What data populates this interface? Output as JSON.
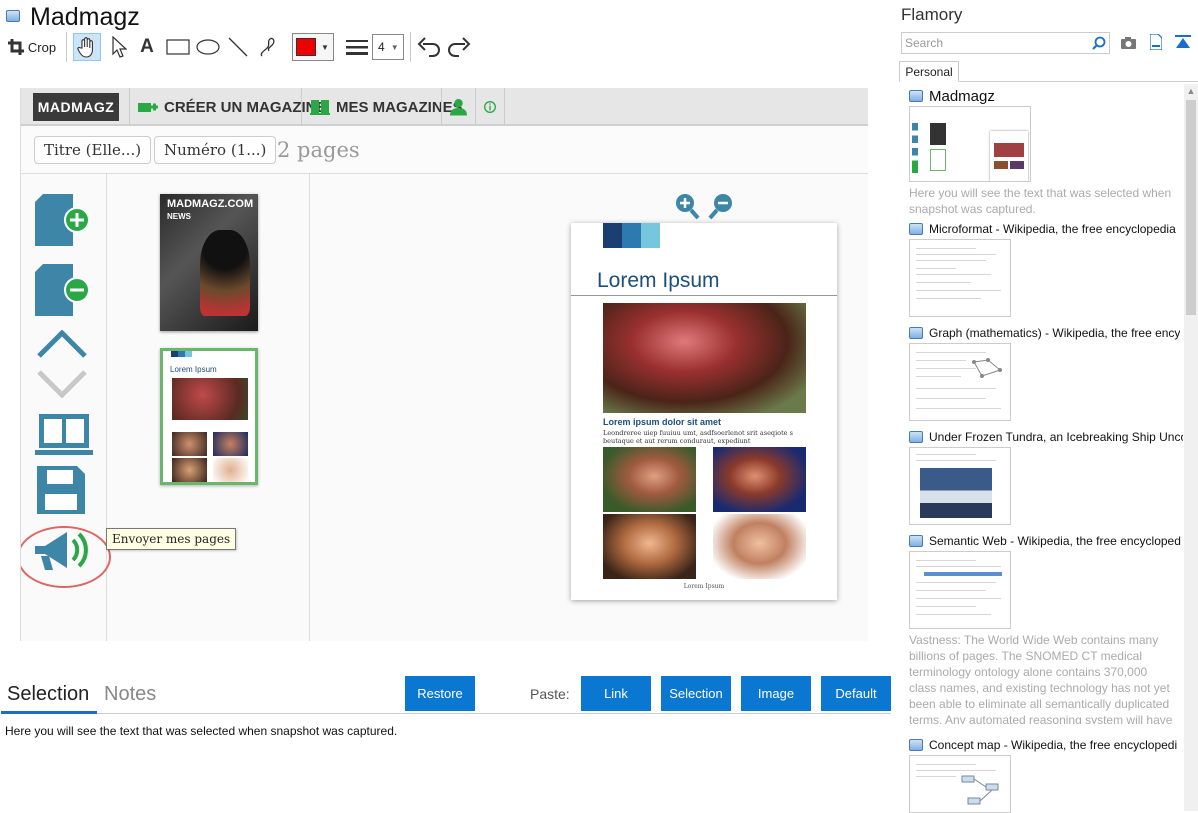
{
  "window": {
    "title": "Madmagz"
  },
  "toolbar": {
    "crop_label": "Crop",
    "pen_size": "4",
    "color": "#ee0000"
  },
  "madmagz": {
    "logo": "MADMAGZ",
    "nav": [
      "CRÉER UN MAGAZINE",
      "MES MAGAZINES"
    ],
    "filter_title": "Titre (Elle...)",
    "filter_number": "Numéro (1...)",
    "page_count": "2 pages",
    "tooltip": "Envoyer mes pages",
    "cover": {
      "brand": "MADMAGZ.COM",
      "section": "NEWS"
    },
    "thumb_title": "Lorem Ipsum",
    "preview": {
      "title": "Lorem Ipsum",
      "caption": "Lorem ipsum dolor sit amet",
      "body": "Leondreree uiep fuuiuu umt, asdfsoerlenot srit aseqiote s beutaque et aut rerum conduraut, expediunt",
      "footer": "Lorem Ipsum"
    }
  },
  "bottom_panel": {
    "tabs": [
      "Selection",
      "Notes"
    ],
    "restore_label": "Restore",
    "paste_label": "Paste:",
    "paste_buttons": [
      "Link",
      "Selection",
      "Image",
      "Default"
    ],
    "selection_text": "Here you will see the text that was selected when snapshot was captured."
  },
  "sidebar": {
    "title": "Flamory",
    "search_placeholder": "Search",
    "tab": "Personal",
    "snapshots": [
      {
        "title": "Madmagz",
        "desc": "Here you will see the text that was selected when snapshot was captured."
      },
      {
        "title": "Microformat - Wikipedia, the free encyclopedia"
      },
      {
        "title": "Graph (mathematics) - Wikipedia, the free ency"
      },
      {
        "title": "Under Frozen Tundra, an Icebreaking Ship Unco"
      },
      {
        "title": "Semantic Web - Wikipedia, the free encycloped",
        "desc": "Vastness: The World Wide Web contains many billions of pages. The SNOMED CT medical terminology ontology alone contains 370,000 class names, and existing technology has not yet been able to eliminate all semantically duplicated terms. Any automated reasoning system will have to deal with truly huge inputs."
      },
      {
        "title": "Concept map - Wikipedia, the free encyclopedi"
      }
    ]
  },
  "colors": {
    "accent": "#0a78d1",
    "preview_title": "#1d4f7a",
    "icon_blue": "#3d86a8",
    "icon_green": "#2aa845"
  }
}
